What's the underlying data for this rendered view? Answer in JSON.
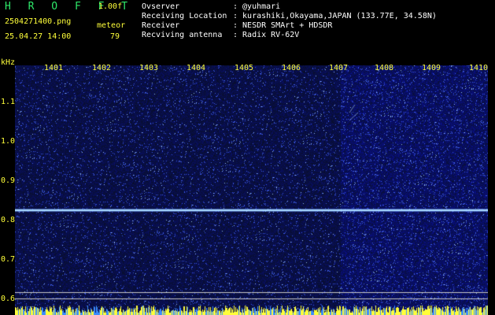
{
  "header": {
    "title": "H R O F F T",
    "version": "1.00f",
    "filename": "2504271400.png",
    "datetime": "25.04.27 14:00",
    "meteor_label": "meteor",
    "meteor_count": "79"
  },
  "station": {
    "observer_label": "Ovserver",
    "observer_value": ": @yuhmari",
    "location_label": "Receiving Location",
    "location_value": ": kurashiki,Okayama,JAPAN (133.77E, 34.58N)",
    "receiver_label": "Receiver",
    "receiver_value": ": NESDR SMArt + HDSDR",
    "antenna_label": "Recviving antenna",
    "antenna_value": ": Radix RV-62V"
  },
  "axes": {
    "y_unit": "kHz",
    "x_ticks": [
      "1401",
      "1402",
      "1403",
      "1404",
      "1405",
      "1406",
      "1407",
      "1408",
      "1409",
      "1410"
    ],
    "y_ticks": [
      "1.1",
      "1.0",
      "0.9",
      "0.8",
      "0.7",
      "0.6"
    ]
  },
  "colors": {
    "accent_green": "#2ee86a",
    "label_yellow": "#ffff3a",
    "background_blue": "#101a80",
    "signal_line": "#a8d8ff"
  }
}
